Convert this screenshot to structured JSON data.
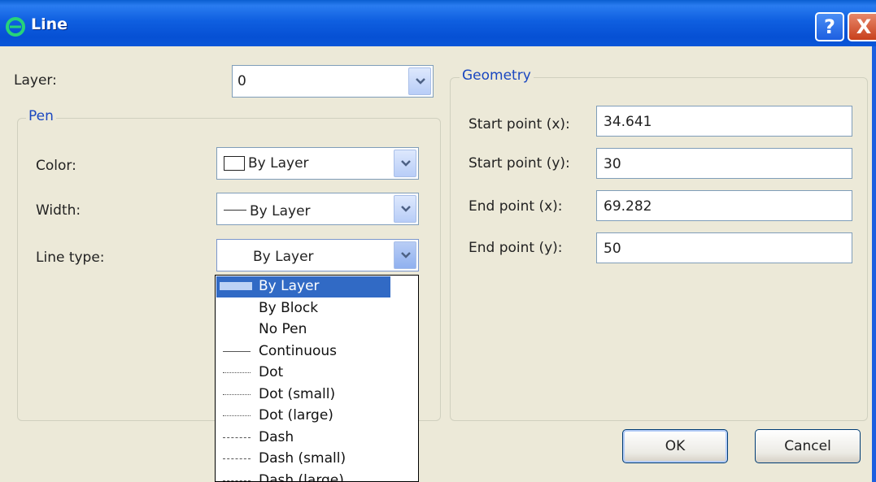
{
  "window": {
    "title": "Line",
    "icon": "app-logo-icon",
    "help_label": "?",
    "close_label": "X"
  },
  "layer": {
    "label": "Layer:",
    "value": "0"
  },
  "pen": {
    "title": "Pen",
    "color_label": "Color:",
    "color_value": "By Layer",
    "width_label": "Width:",
    "width_value": "By Layer",
    "line_type_label": "Line type:",
    "line_type_value": "By Layer"
  },
  "geometry": {
    "title": "Geometry",
    "start_x_label": "Start point (x):",
    "start_x_value": "34.641",
    "start_y_label": "Start point (y):",
    "start_y_value": "30",
    "end_x_label": "End point (x):",
    "end_x_value": "69.282",
    "end_y_label": "End point (y):",
    "end_y_value": "50"
  },
  "line_type_options": [
    {
      "label": "By Layer",
      "sample": "none",
      "selected": true
    },
    {
      "label": "By Block",
      "sample": "none"
    },
    {
      "label": "No Pen",
      "sample": "none"
    },
    {
      "label": "Continuous",
      "sample": "solid"
    },
    {
      "label": "Dot",
      "sample": "dotted"
    },
    {
      "label": "Dot (small)",
      "sample": "dotted"
    },
    {
      "label": "Dot (large)",
      "sample": "dotted"
    },
    {
      "label": "Dash",
      "sample": "dashed"
    },
    {
      "label": "Dash (small)",
      "sample": "dashed"
    },
    {
      "label": "Dash (large)",
      "sample": "dashed"
    }
  ],
  "buttons": {
    "ok": "OK",
    "cancel": "Cancel"
  },
  "colors": {
    "titlebar": "#0a56d8",
    "dialog_bg": "#ece9d8",
    "group_title": "#1a47c0",
    "selection": "#316ac5"
  }
}
